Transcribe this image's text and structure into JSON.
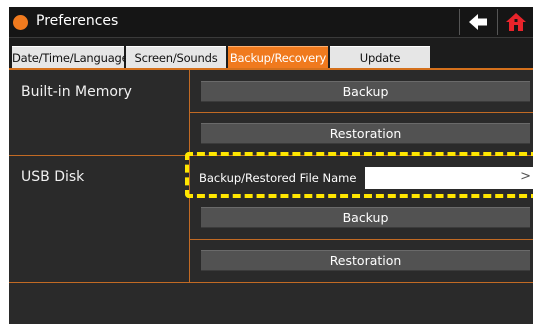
{
  "window": {
    "title": "Preferences",
    "accent_color": "#f07a1e",
    "icons": {
      "title": "status-dot-icon",
      "back": "back-arrow-icon",
      "home": "home-icon"
    }
  },
  "tabs": [
    {
      "label": "Date/Time/Language",
      "active": false
    },
    {
      "label": "Screen/Sounds",
      "active": false
    },
    {
      "label": "Backup/Recovery",
      "active": true
    },
    {
      "label": "Update",
      "active": false
    }
  ],
  "builtin_memory": {
    "label": "Built-in Memory",
    "backup_label": "Backup",
    "restoration_label": "Restoration"
  },
  "usb_disk": {
    "label": "USB Disk",
    "file_name_label": "Backup/Restored File Name",
    "file_name_value": "",
    "file_name_chevron": ">",
    "backup_label": "Backup",
    "restoration_label": "Restoration",
    "highlight_color": "#ffe600"
  }
}
